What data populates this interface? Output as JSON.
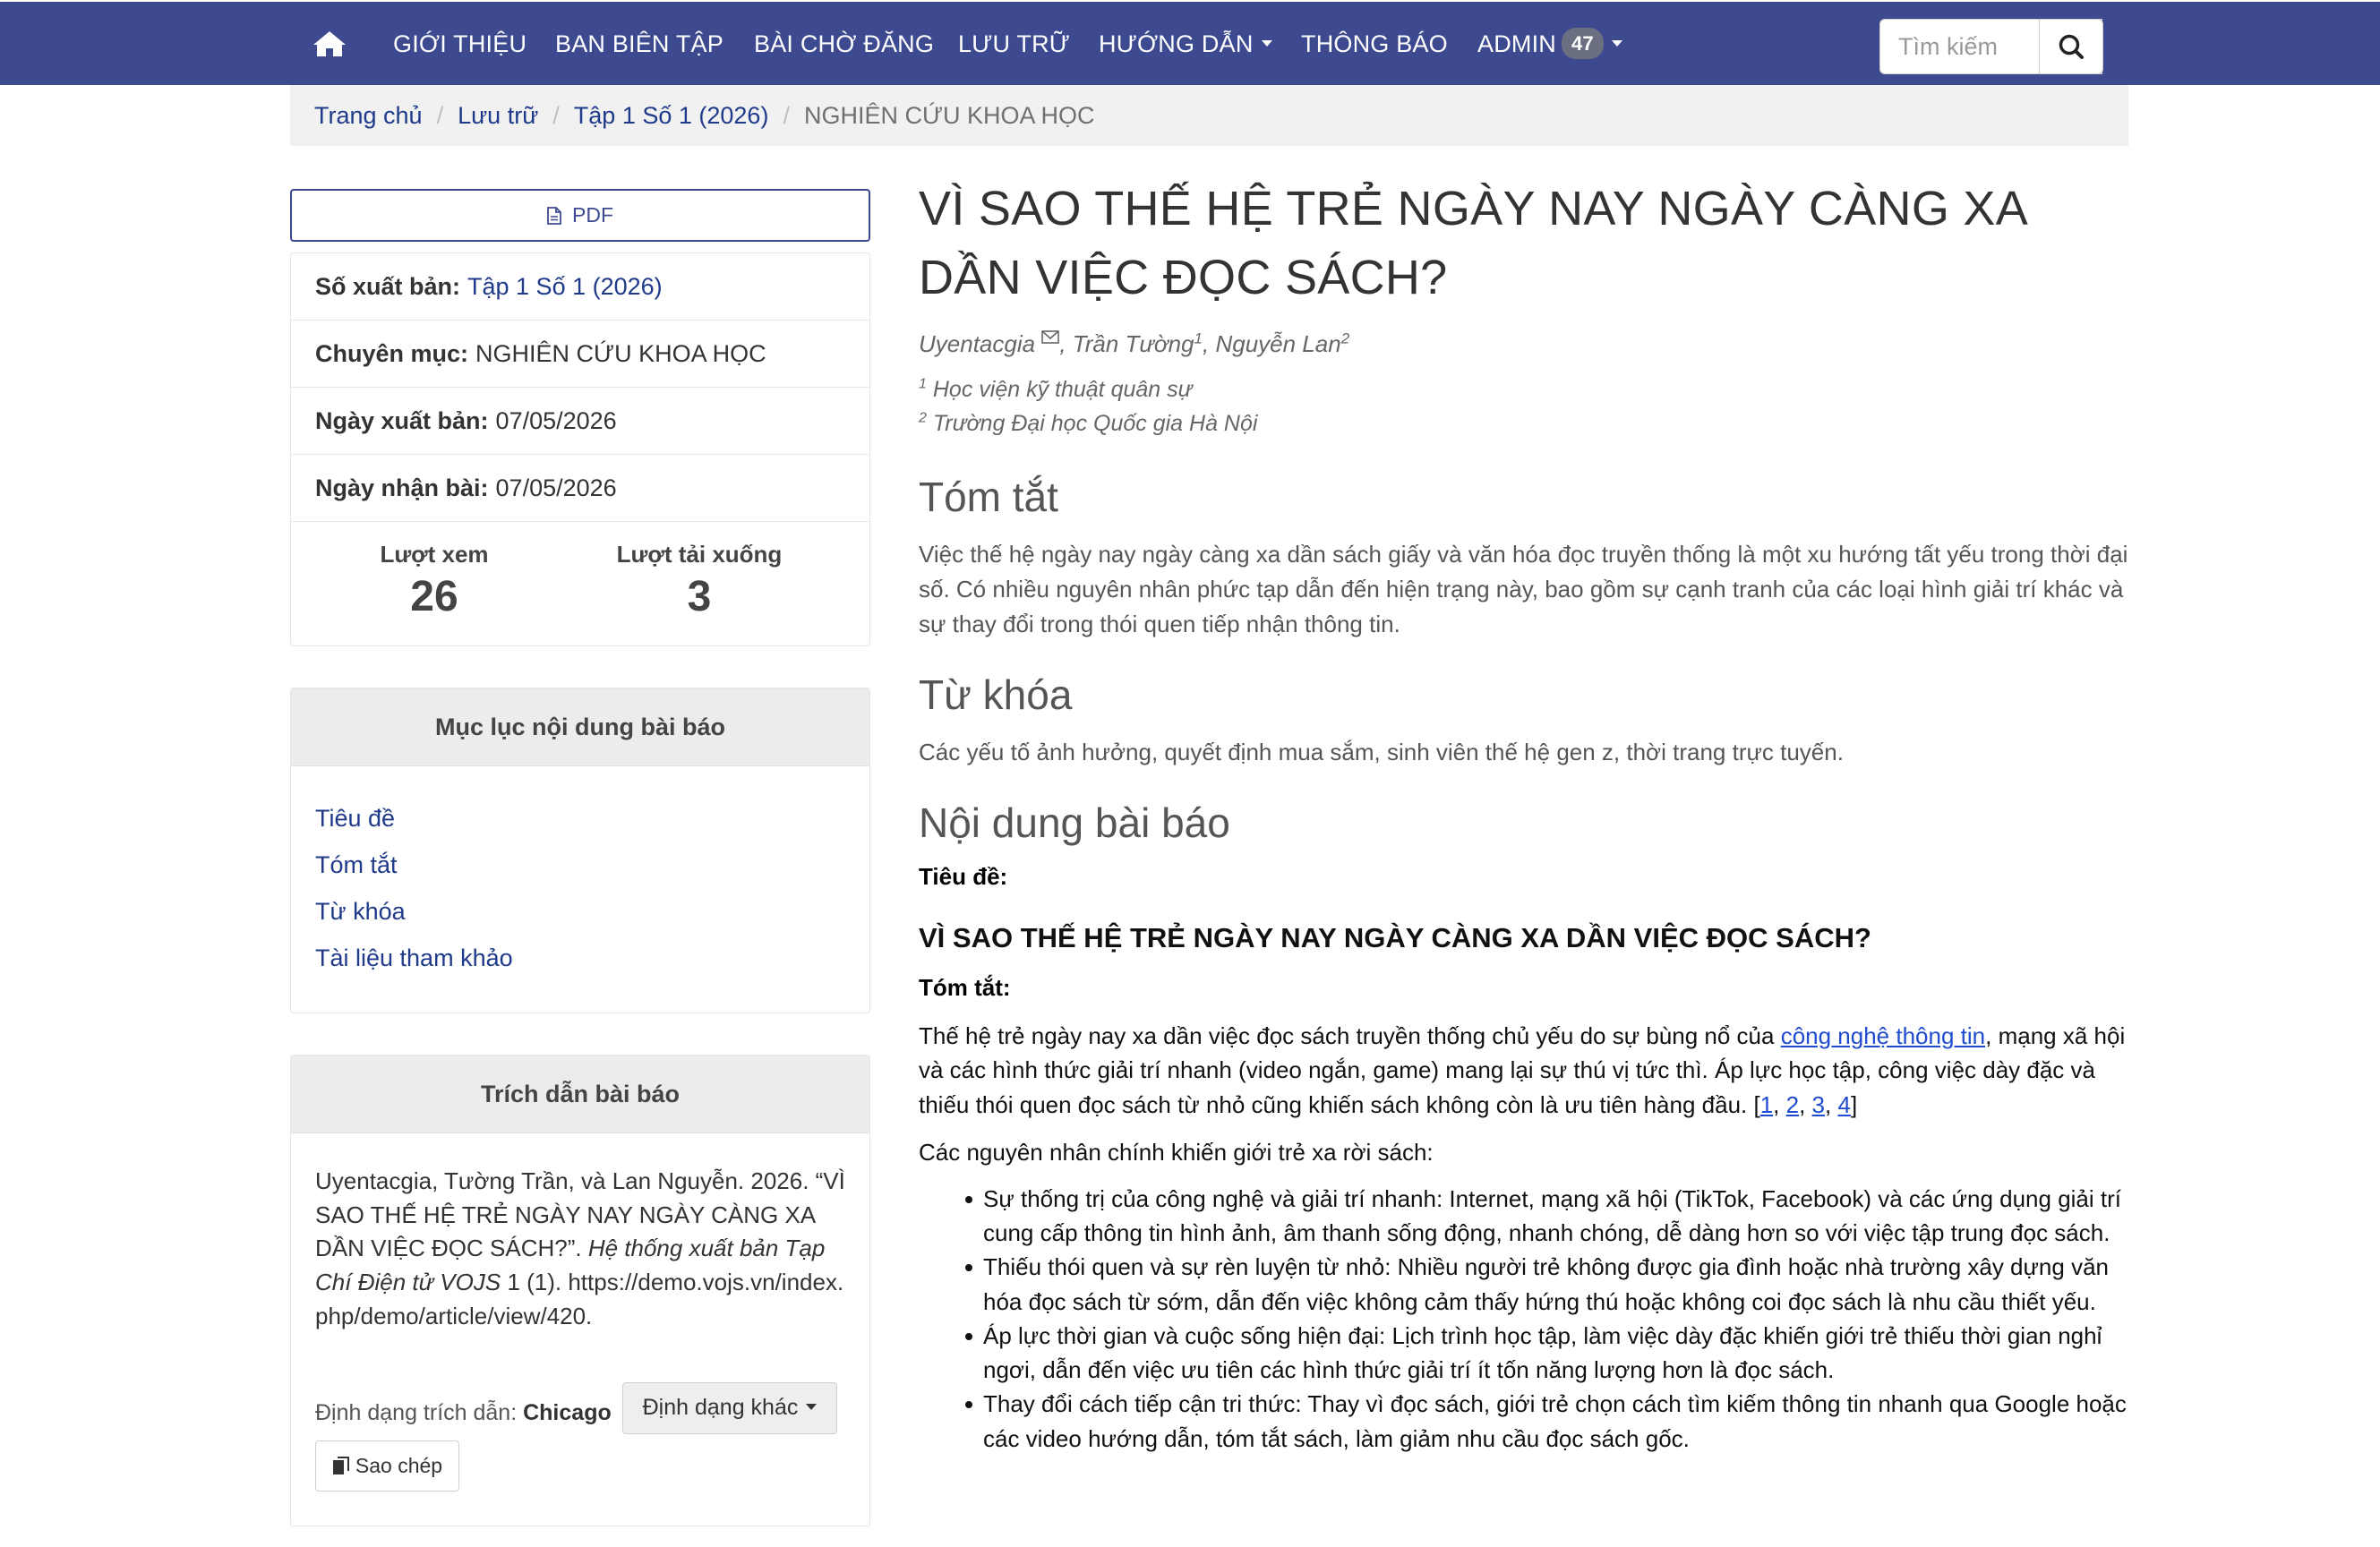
{
  "nav": {
    "items": [
      {
        "label": "GIỚI THIỆU"
      },
      {
        "label": "BAN BIÊN TẬP"
      },
      {
        "label": "BÀI CHỜ ĐĂNG"
      },
      {
        "label": "LƯU TRỮ"
      },
      {
        "label": "HƯỚNG DẪN"
      },
      {
        "label": "THÔNG BÁO"
      },
      {
        "label": "ADMIN"
      }
    ],
    "admin_badge": "47",
    "search_placeholder": "Tìm kiếm",
    "colors": {
      "bar": "#3e4a8f",
      "text": "#ffffff"
    }
  },
  "breadcrumb": {
    "items": [
      "Trang chủ",
      "Lưu trữ",
      "Tập 1 Số 1 (2026)"
    ],
    "current": "NGHIÊN CỨU KHOA HỌC"
  },
  "sidebar": {
    "pdf_label": "PDF",
    "issue_label": "Số xuất bản:",
    "issue_value": "Tập 1 Số 1 (2026)",
    "section_label": "Chuyên mục:",
    "section_value": "NGHIÊN CỨU KHOA HỌC",
    "published_label": "Ngày xuất bản:",
    "published_value": "07/05/2026",
    "received_label": "Ngày nhận bài:",
    "received_value": "07/05/2026",
    "views_label": "Lượt xem",
    "views_value": "26",
    "downloads_label": "Lượt tải xuống",
    "downloads_value": "3",
    "toc_title": "Mục lục nội dung bài báo",
    "toc": [
      "Tiêu đề",
      "Tóm tắt",
      "Từ khóa",
      "Tài liệu tham khảo"
    ],
    "cite_title": "Trích dẫn bài báo",
    "cite_text_1": "Uyentacgia, Tường Trần, và Lan Nguyễn. 2026. “VÌ SAO THẾ HỆ TRẺ NGÀY NAY NGÀY CÀNG XA DẦN VIỆC ĐỌC SÁCH?”. ",
    "cite_text_italic": "Hệ thống xuất bản Tạp Chí Điện tử VOJS",
    "cite_text_2": " 1 (1). https://demo.vojs.vn/index.php/demo/article/view/420.",
    "cite_format_label": "Định dạng trích dẫn:",
    "cite_format_value": "Chicago",
    "other_format_label": "Định dạng khác",
    "copy_label": "Sao chép"
  },
  "article": {
    "title": "VÌ SAO THẾ HỆ TRẺ NGÀY NAY NGÀY CÀNG XA DẦN VIỆC ĐỌC SÁCH?",
    "author1": "Uyentacgia",
    "author2": "Trần Tường",
    "author2_sup": "1",
    "author3": "Nguyễn Lan",
    "author3_sup": "2",
    "affil1_sup": "1",
    "affil1": "Học viện kỹ thuật quân sự",
    "affil2_sup": "2",
    "affil2": "Trường Đại học Quốc gia Hà Nội",
    "abstract_heading": "Tóm tắt",
    "abstract": "Việc thế hệ ngày nay ngày càng xa dần sách giấy và văn hóa đọc truyền thống là một xu hướng tất yếu trong thời đại số. Có nhiều nguyên nhân phức tạp dẫn đến hiện trạng này, bao gồm sự cạnh tranh của các loại hình giải trí khác và sự thay đổi trong thói quen tiếp nhận thông tin.",
    "keywords_heading": "Từ khóa",
    "keywords": "Các yếu tố ảnh hưởng, quyết định mua sắm, sinh viên thế hệ gen z, thời trang trực tuyến.",
    "content_heading": "Nội dung bài báo",
    "content_title_label": "Tiêu đề:",
    "content_title": "VÌ SAO THẾ HỆ TRẺ NGÀY NAY NGÀY CÀNG XA DẦN VIỆC ĐỌC SÁCH?",
    "content_abstract_label": "Tóm tắt:",
    "body_p1_a": "Thế hệ trẻ ngày nay xa dần việc đọc sách truyền thống chủ yếu do sự bùng nổ của ",
    "body_p1_link": "công nghệ thông tin",
    "body_p1_b": ", mạng xã hội và các hình thức giải trí nhanh (video ngắn, game) mang lại sự thú vị tức thì. Áp lực học tập, công việc dày đặc và thiếu thói quen đọc sách từ nhỏ cũng khiến sách không còn là ưu tiên hàng đầu. [",
    "refs": [
      "1",
      "2",
      "3",
      "4"
    ],
    "body_p1_c": "]",
    "causes_intro": "Các nguyên nhân chính khiến giới trẻ xa rời sách:",
    "causes": [
      "Sự thống trị của công nghệ và giải trí nhanh: Internet, mạng xã hội (TikTok, Facebook) và các ứng dụng giải trí cung cấp thông tin hình ảnh, âm thanh sống động, nhanh chóng, dễ dàng hơn so với việc tập trung đọc sách.",
      "Thiếu thói quen và sự rèn luyện từ nhỏ: Nhiều người trẻ không được gia đình hoặc nhà trường xây dựng văn hóa đọc sách từ sớm, dẫn đến việc không cảm thấy hứng thú hoặc không coi đọc sách là nhu cầu thiết yếu.",
      "Áp lực thời gian và cuộc sống hiện đại: Lịch trình học tập, làm việc dày đặc khiến giới trẻ thiếu thời gian nghỉ ngơi, dẫn đến việc ưu tiên các hình thức giải trí ít tốn năng lượng hơn là đọc sách.",
      "Thay đổi cách tiếp cận tri thức: Thay vì đọc sách, giới trẻ chọn cách tìm kiếm thông tin nhanh qua Google hoặc các video hướng dẫn, tóm tắt sách, làm giảm nhu cầu đọc sách gốc."
    ]
  }
}
